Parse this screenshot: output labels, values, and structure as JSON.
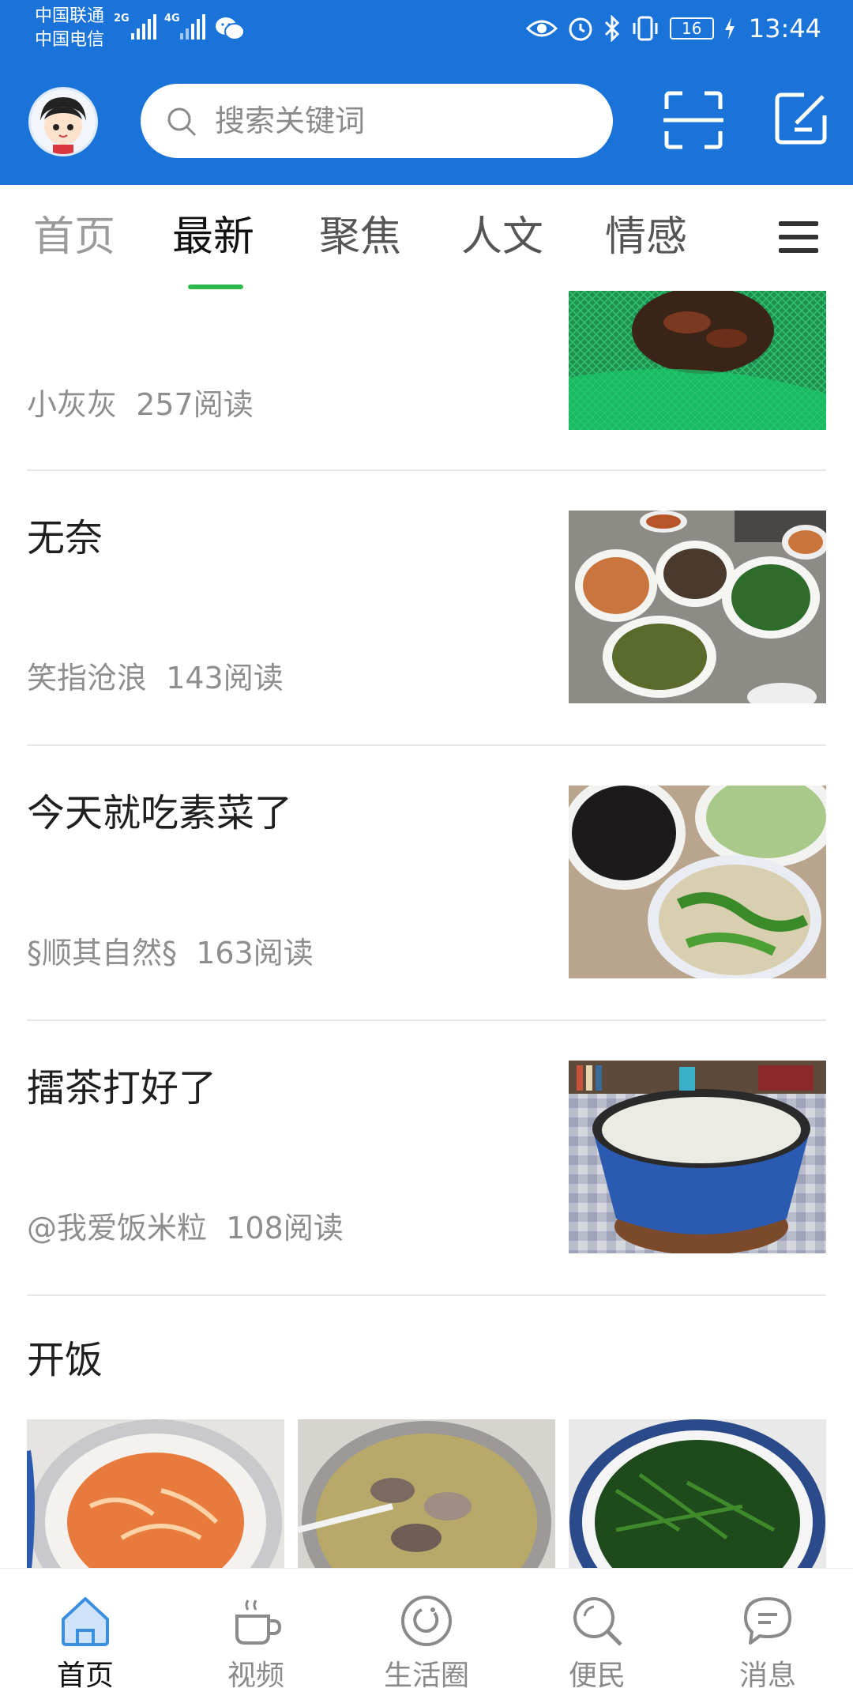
{
  "status": {
    "carrier1": "中国联通",
    "carrier2": "中国电信",
    "net1": "2G",
    "net2": "4G",
    "battery": "16",
    "time": "13:44"
  },
  "header": {
    "search_placeholder": "搜索关键词",
    "avatar_icon": "cartoon-girl-avatar",
    "scan_icon": "scan-frame-icon",
    "edit_icon": "compose-edit-icon"
  },
  "tabs": {
    "items": [
      "首页",
      "最新",
      "聚焦",
      "人文",
      "情感"
    ],
    "active": "最新",
    "accent": "#2fb84c"
  },
  "feed": {
    "items": [
      {
        "title": "",
        "author": "小灰灰",
        "reads": "257阅读"
      },
      {
        "title": "无奈",
        "author": "笑指沧浪",
        "reads": "143阅读"
      },
      {
        "title": "今天就吃素菜了",
        "author": "§顺其自然§",
        "reads": "163阅读"
      },
      {
        "title": "擂茶打好了",
        "author": "@我爱饭米粒",
        "reads": "108阅读"
      },
      {
        "title": "开饭",
        "author": "",
        "reads": ""
      }
    ]
  },
  "bottom_nav": {
    "items": [
      {
        "label": "首页",
        "icon": "home-icon"
      },
      {
        "label": "视频",
        "icon": "coffee-cup-icon"
      },
      {
        "label": "生活圈",
        "icon": "life-circle-icon"
      },
      {
        "label": "便民",
        "icon": "search-service-icon"
      },
      {
        "label": "消息",
        "icon": "message-bubble-icon"
      }
    ],
    "active": "首页"
  },
  "colors": {
    "brand_blue": "#1a73d9",
    "tab_underline": "#2fb84c"
  }
}
